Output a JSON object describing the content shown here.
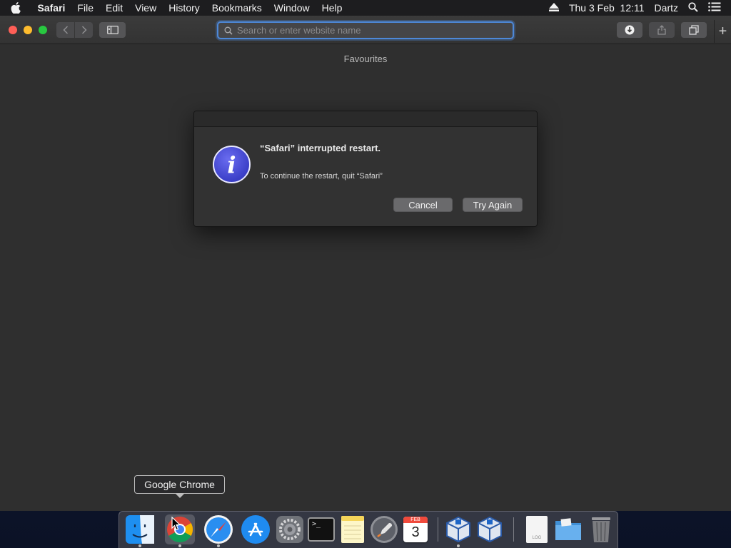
{
  "menubar": {
    "app_name": "Safari",
    "items": [
      "File",
      "Edit",
      "View",
      "History",
      "Bookmarks",
      "Window",
      "Help"
    ],
    "clock": "Thu 3 Feb  12:11",
    "user": "Dartz",
    "icons": [
      "apple-icon",
      "eject-icon",
      "spotlight-icon",
      "notification-center-icon"
    ]
  },
  "browser": {
    "address_placeholder": "Search or enter website name",
    "page_heading": "Favourites",
    "new_tab_symbol": "+"
  },
  "dialog": {
    "title": "“Safari” interrupted restart.",
    "message": "To continue the restart, quit “Safari”",
    "icon_glyph": "i",
    "cancel_label": "Cancel",
    "retry_label": "Try Again"
  },
  "tooltip": {
    "text": "Google Chrome"
  },
  "dock": {
    "apps": [
      {
        "name": "Finder",
        "icon": "finder-icon",
        "running": true
      },
      {
        "name": "Google Chrome",
        "icon": "chrome-icon",
        "running": true
      },
      {
        "name": "Safari",
        "icon": "safari-icon",
        "running": true
      },
      {
        "name": "App Store",
        "icon": "app-store-icon",
        "running": false
      },
      {
        "name": "System Preferences",
        "icon": "system-preferences-icon",
        "running": false
      },
      {
        "name": "Terminal",
        "icon": "terminal-icon",
        "running": false
      },
      {
        "name": "Notes",
        "icon": "notes-icon",
        "running": false
      },
      {
        "name": "Launchpad",
        "icon": "launchpad-icon",
        "running": false
      },
      {
        "name": "Calendar",
        "icon": "calendar-icon",
        "running": false
      },
      {
        "name": "VirtualBox",
        "icon": "virtualbox-icon",
        "running": true
      },
      {
        "name": "VirtualBox VM",
        "icon": "virtualbox-vm-icon",
        "running": false
      },
      {
        "name": "Document",
        "icon": "document-icon",
        "running": false
      },
      {
        "name": "Folder",
        "icon": "folder-icon",
        "running": false
      },
      {
        "name": "Trash",
        "icon": "trash-icon",
        "running": false
      }
    ],
    "calendar_month": "FEB",
    "calendar_day": "3",
    "terminal_prompt": ">_",
    "document_caption": "LOG"
  },
  "colors": {
    "accent": "#4d88d8",
    "close": "#ff5f57",
    "minimize": "#febc2e",
    "maximize": "#28c840",
    "info_icon": "#4447d0"
  }
}
